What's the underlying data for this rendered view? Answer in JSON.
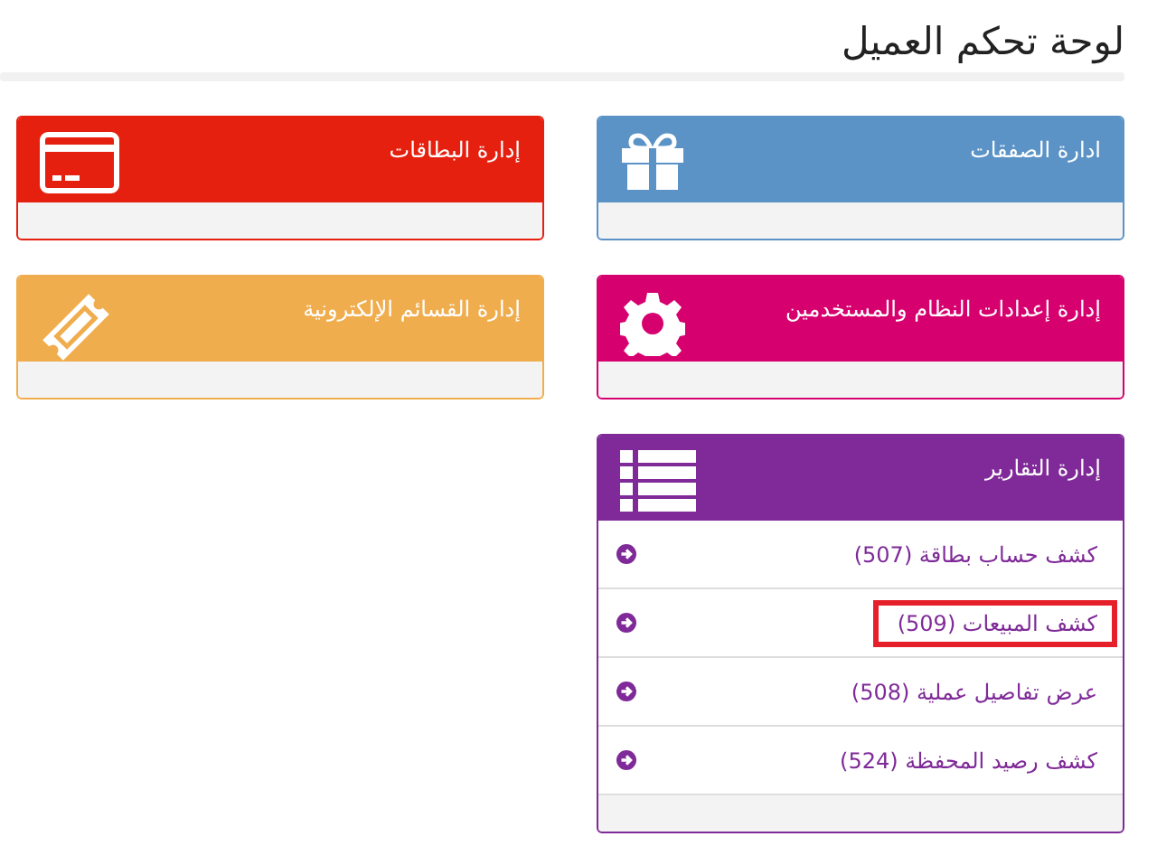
{
  "page_title": "لوحة تحكم العميل",
  "cards": [
    {
      "title": "ادارة الصفقات",
      "kind": "gift",
      "color": "#5b93c7"
    },
    {
      "title": "إدارة البطاقات",
      "kind": "card",
      "color": "#e5200f"
    },
    {
      "title": "إدارة إعدادات النظام والمستخدمين",
      "kind": "gear",
      "color": "#d6006f"
    },
    {
      "title": "إدارة القسائم الإلكترونية",
      "kind": "ticket",
      "color": "#f0ad4e"
    },
    {
      "title": "إدارة التقارير",
      "kind": "list",
      "color": "#7f2a98",
      "items": [
        {
          "label": "كشف حساب بطاقة (507)",
          "highlighted": false
        },
        {
          "label": "كشف المبيعات (509)",
          "highlighted": true
        },
        {
          "label": "عرض تفاصيل عملية (508)",
          "highlighted": false
        },
        {
          "label": "كشف رصيد المحفظة (524)",
          "highlighted": false
        }
      ]
    }
  ]
}
